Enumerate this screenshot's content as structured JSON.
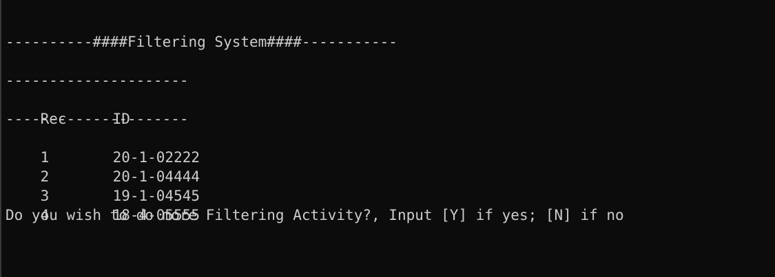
{
  "terminal": {
    "title_line": "----------####Filtering System####-----------",
    "separator_top": "---------------------",
    "header": {
      "rec": "Rec",
      "id": "ID"
    },
    "separator_bottom": "---------------------",
    "rows": [
      {
        "rec": "1",
        "id": "20-1-02222"
      },
      {
        "rec": "2",
        "id": "20-1-04444"
      },
      {
        "rec": "3",
        "id": "19-1-04545"
      },
      {
        "rec": "4",
        "id": "18-4-05555"
      }
    ],
    "prompt": "Do you wish to do more Filtering Activity?, Input [Y] if yes; [N] if no",
    "colors": {
      "background": "#0c0c0c",
      "foreground": "#cccccc"
    }
  }
}
